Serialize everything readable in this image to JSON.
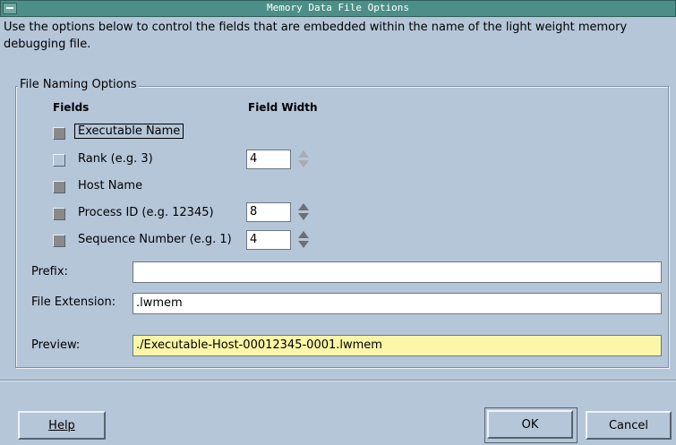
{
  "window": {
    "title": "Memory Data File Options"
  },
  "intro_text": "Use the options below to control the fields that are embedded within the name of the light weight memory debugging file.",
  "group": {
    "legend": "File Naming Options",
    "col_fields": "Fields",
    "col_width": "Field Width",
    "items": [
      {
        "label": "Executable Name",
        "checked": true,
        "width": null
      },
      {
        "label": "Rank (e.g. 3)",
        "checked": false,
        "width": "4"
      },
      {
        "label": "Host Name",
        "checked": true,
        "width": null
      },
      {
        "label": "Process ID (e.g. 12345)",
        "checked": true,
        "width": "8"
      },
      {
        "label": "Sequence Number (e.g. 1)",
        "checked": true,
        "width": "4"
      }
    ],
    "prefix_label": "Prefix:",
    "prefix_value": "",
    "extension_label": "File Extension:",
    "extension_value": ".lwmem",
    "preview_label": "Preview:",
    "preview_value": "./Executable-Host-00012345-0001.lwmem"
  },
  "buttons": {
    "help": "Help",
    "ok": "OK",
    "cancel": "Cancel"
  }
}
